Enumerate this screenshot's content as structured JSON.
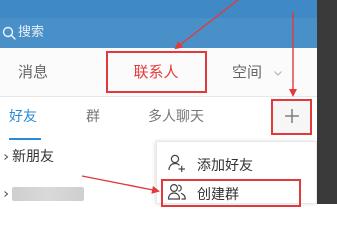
{
  "search": {
    "placeholder": "搜索",
    "icon": "search-icon"
  },
  "main_tabs": [
    {
      "label": "消息"
    },
    {
      "label": "联系人",
      "active": true
    },
    {
      "label": "空间"
    }
  ],
  "sub_tabs": [
    {
      "label": "好友",
      "active": true
    },
    {
      "label": "群"
    },
    {
      "label": "多人聊天"
    }
  ],
  "add_button": {
    "icon": "plus-icon"
  },
  "list": {
    "items": [
      {
        "label": "新朋友"
      }
    ]
  },
  "dropdown": {
    "items": [
      {
        "label": "添加好友",
        "icon": "add-user-icon"
      },
      {
        "label": "创建群",
        "icon": "group-icon",
        "highlighted": true
      }
    ]
  },
  "colors": {
    "search_bg": "#4a90c8",
    "active_tab_text": "#e63c3c",
    "active_subtab_text": "#2b8ad7",
    "annotation_red": "#e23a3a",
    "side_panel": "#3a3a3a"
  }
}
